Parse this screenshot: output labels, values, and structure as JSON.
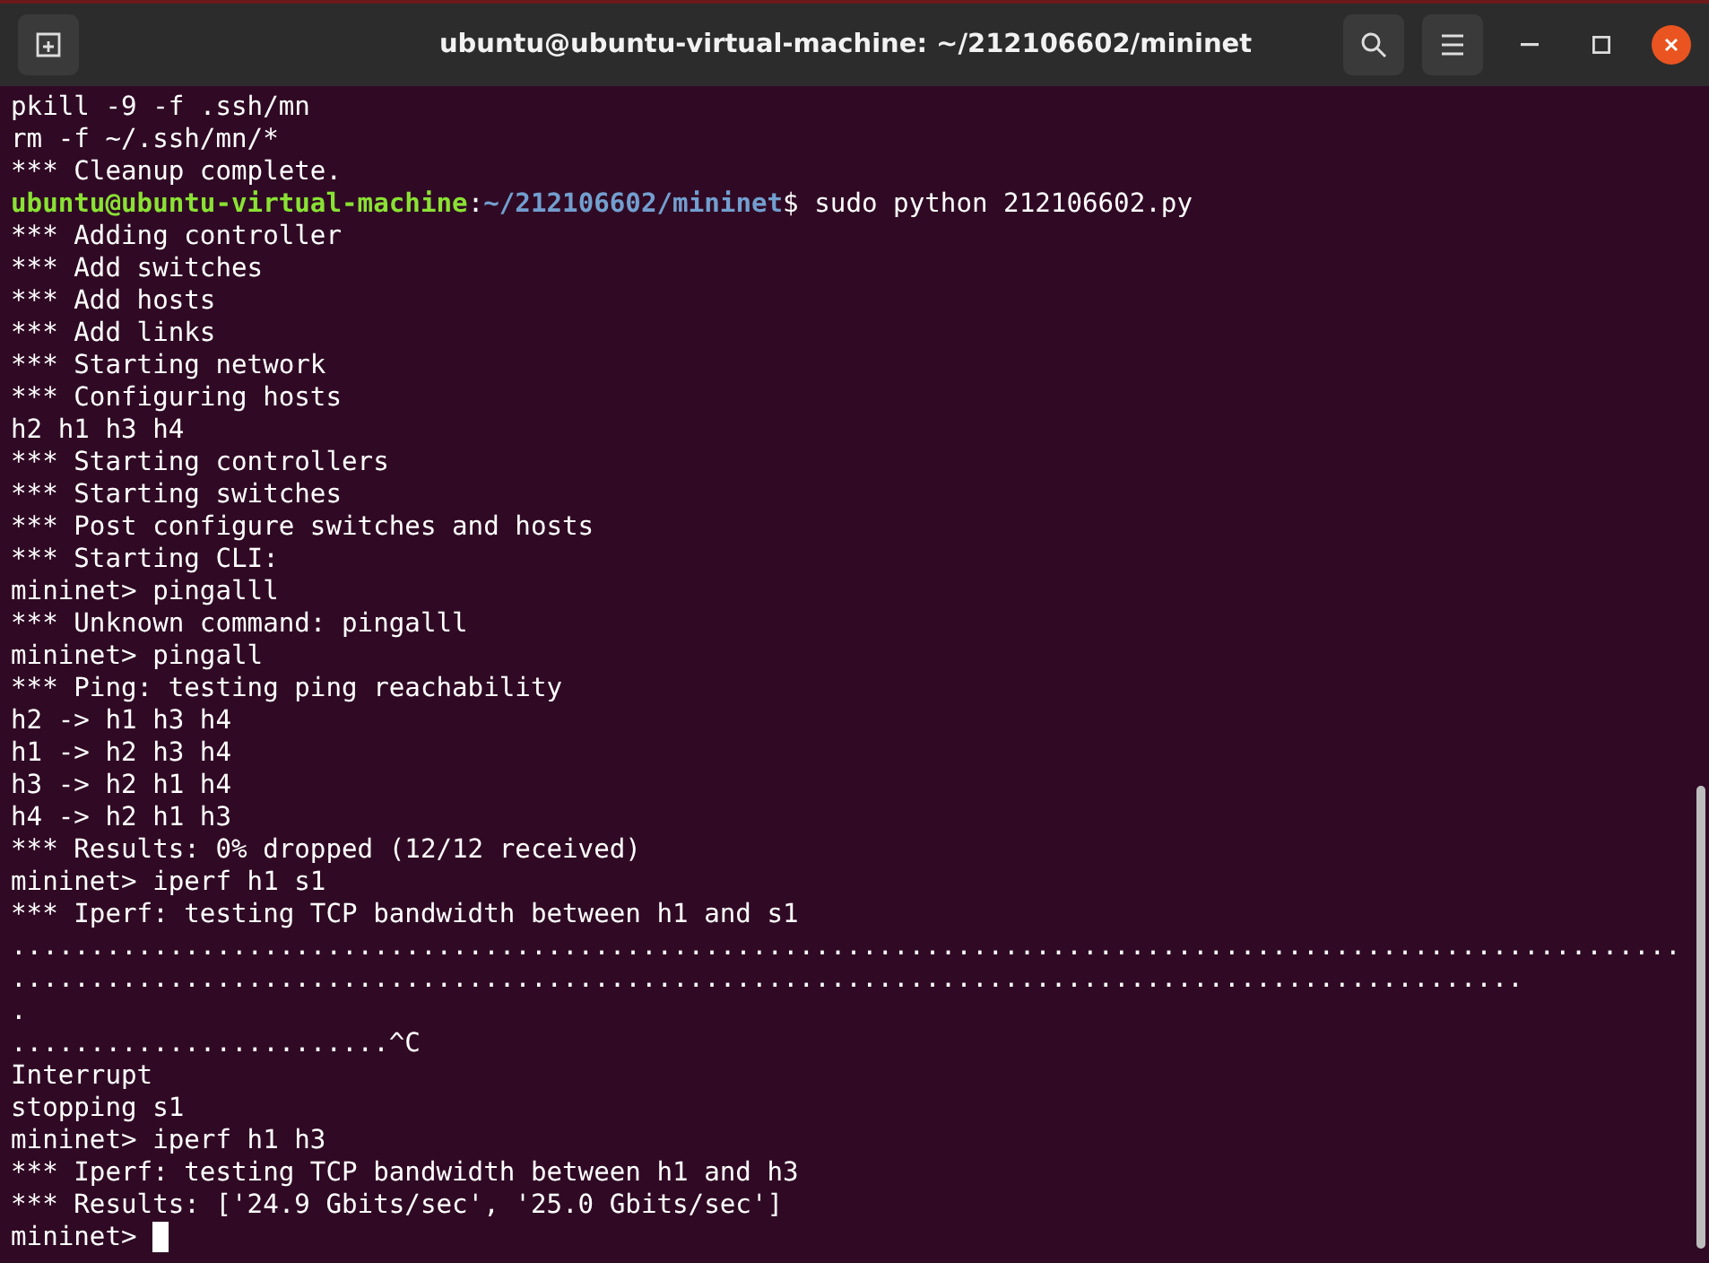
{
  "window": {
    "title": "ubuntu@ubuntu-virtual-machine: ~/212106602/mininet"
  },
  "terminal": {
    "lines": [
      {
        "kind": "plain",
        "text": "pkill -9 -f .ssh/mn"
      },
      {
        "kind": "plain",
        "text": "rm -f ~/.ssh/mn/*"
      },
      {
        "kind": "plain",
        "text": "*** Cleanup complete."
      },
      {
        "kind": "prompt",
        "user": "ubuntu@ubuntu-virtual-machine",
        "sep": ":",
        "path": "~/212106602/mininet",
        "text": "$ sudo python 212106602.py"
      },
      {
        "kind": "plain",
        "text": "*** Adding controller"
      },
      {
        "kind": "plain",
        "text": "*** Add switches"
      },
      {
        "kind": "plain",
        "text": "*** Add hosts"
      },
      {
        "kind": "plain",
        "text": "*** Add links"
      },
      {
        "kind": "plain",
        "text": "*** Starting network"
      },
      {
        "kind": "plain",
        "text": "*** Configuring hosts"
      },
      {
        "kind": "plain",
        "text": "h2 h1 h3 h4"
      },
      {
        "kind": "plain",
        "text": "*** Starting controllers"
      },
      {
        "kind": "plain",
        "text": "*** Starting switches"
      },
      {
        "kind": "plain",
        "text": "*** Post configure switches and hosts"
      },
      {
        "kind": "plain",
        "text": "*** Starting CLI:"
      },
      {
        "kind": "plain",
        "text": "mininet> pingalll"
      },
      {
        "kind": "plain",
        "text": "*** Unknown command: pingalll"
      },
      {
        "kind": "plain",
        "text": "mininet> pingall"
      },
      {
        "kind": "plain",
        "text": "*** Ping: testing ping reachability"
      },
      {
        "kind": "plain",
        "text": "h2 -> h1 h3 h4"
      },
      {
        "kind": "plain",
        "text": "h1 -> h2 h3 h4"
      },
      {
        "kind": "plain",
        "text": "h3 -> h2 h1 h4"
      },
      {
        "kind": "plain",
        "text": "h4 -> h2 h1 h3"
      },
      {
        "kind": "plain",
        "text": "*** Results: 0% dropped (12/12 received)"
      },
      {
        "kind": "plain",
        "text": "mininet> iperf h1 s1"
      },
      {
        "kind": "plain",
        "text": "*** Iperf: testing TCP bandwidth between h1 and s1"
      },
      {
        "kind": "plain",
        "text": ".........................................................................................................."
      },
      {
        "kind": "plain",
        "text": "................................................................................................"
      },
      {
        "kind": "plain",
        "text": "."
      },
      {
        "kind": "plain",
        "text": "........................^C"
      },
      {
        "kind": "plain",
        "text": "Interrupt"
      },
      {
        "kind": "plain",
        "text": "stopping s1"
      },
      {
        "kind": "plain",
        "text": "mininet> iperf h1 h3"
      },
      {
        "kind": "plain",
        "text": "*** Iperf: testing TCP bandwidth between h1 and h3"
      },
      {
        "kind": "plain",
        "text": "*** Results: ['24.9 Gbits/sec', '25.0 Gbits/sec']"
      },
      {
        "kind": "cursor",
        "text": "mininet> "
      }
    ]
  }
}
